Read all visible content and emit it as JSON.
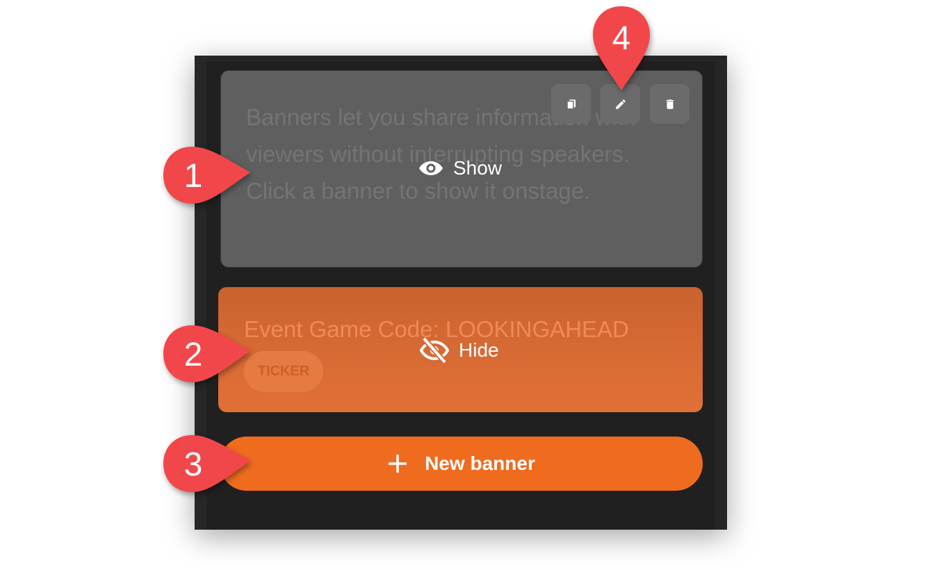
{
  "banners": [
    {
      "text": "Banners let you share information with viewers without interrupting speakers. Click a banner to show it onstage.",
      "overlay_label": "Show",
      "overlay_icon": "eye-icon",
      "actions": [
        {
          "icon": "copy-icon",
          "label": "Duplicate"
        },
        {
          "icon": "pencil-icon",
          "label": "Edit"
        },
        {
          "icon": "trash-icon",
          "label": "Delete"
        }
      ]
    },
    {
      "text": "Event Game Code: LOOKINGAHEAD",
      "badge": "TICKER",
      "overlay_label": "Hide",
      "overlay_icon": "eye-slash-icon"
    }
  ],
  "new_banner_label": "New banner",
  "callouts": [
    "1",
    "2",
    "3",
    "4"
  ],
  "colors": {
    "accent": "#ef6c1f",
    "callout": "#f2474a",
    "panel": "#262626",
    "banner_gray": "#5f5f5f",
    "banner_orange": "#d76a34"
  }
}
